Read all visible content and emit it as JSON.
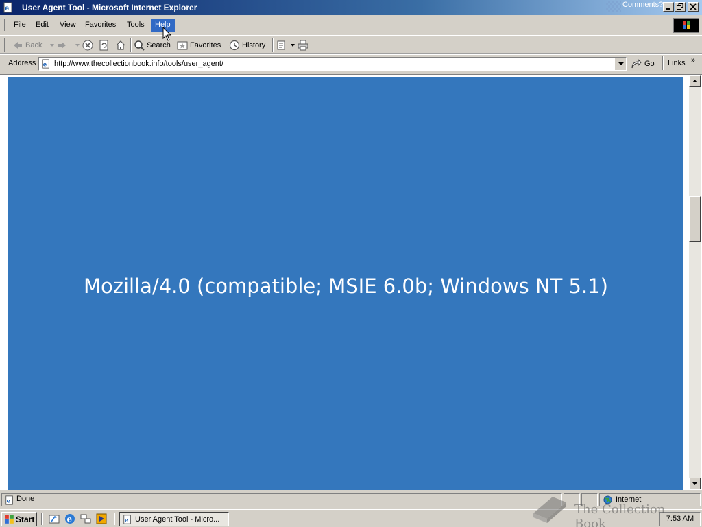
{
  "window": {
    "title": "User Agent Tool - Microsoft Internet Explorer",
    "comments_link": "Comments?"
  },
  "menu": {
    "items": [
      "File",
      "Edit",
      "View",
      "Favorites",
      "Tools",
      "Help"
    ],
    "active": "Help"
  },
  "toolbar": {
    "back_label": "Back",
    "search_label": "Search",
    "favorites_label": "Favorites",
    "history_label": "History"
  },
  "address": {
    "label": "Address",
    "url": "http://www.thecollectionbook.info/tools/user_agent/",
    "go_label": "Go",
    "links_label": "Links"
  },
  "page": {
    "user_agent": "Mozilla/4.0 (compatible; MSIE 6.0b; Windows NT 5.1)",
    "background_color": "#3477bd"
  },
  "status": {
    "text": "Done",
    "zone": "Internet"
  },
  "taskbar": {
    "start_label": "Start",
    "task_label": "User Agent Tool - Micro...",
    "clock": "7:53 AM"
  },
  "watermark": {
    "text": "The Collection Book"
  }
}
